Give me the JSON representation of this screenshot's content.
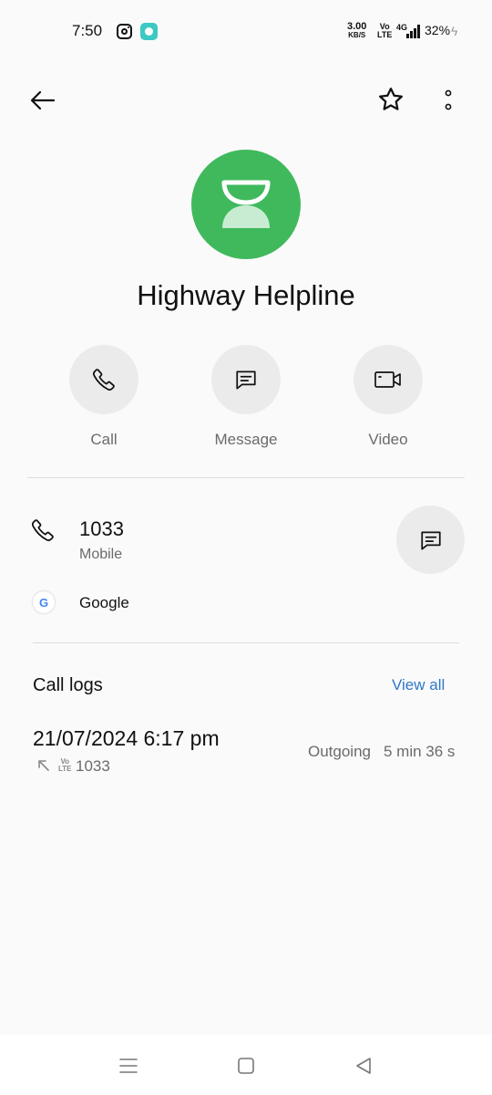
{
  "status_bar": {
    "time": "7:50",
    "net_speed_value": "3.00",
    "net_speed_unit": "KB/S",
    "volte_top": "Vo",
    "volte_bottom": "LTE",
    "network": "4G",
    "battery": "32%"
  },
  "contact": {
    "name": "Highway Helpline",
    "avatar_color": "#40b95c",
    "avatar_icon": "hourglass-icon"
  },
  "actions": {
    "call_label": "Call",
    "message_label": "Message",
    "video_label": "Video"
  },
  "number": {
    "value": "1033",
    "type": "Mobile"
  },
  "account": {
    "label": "Google"
  },
  "call_logs": {
    "title": "Call logs",
    "view_all": "View all",
    "entries": [
      {
        "datetime": "21/07/2024 6:17 pm",
        "volte_top": "Vo",
        "volte_bottom": "LTE",
        "number": "1033",
        "status": "Outgoing",
        "duration": "5 min 36 s"
      }
    ]
  },
  "colors": {
    "accent_link": "#2f77c8",
    "button_bg": "#ebebeb"
  }
}
